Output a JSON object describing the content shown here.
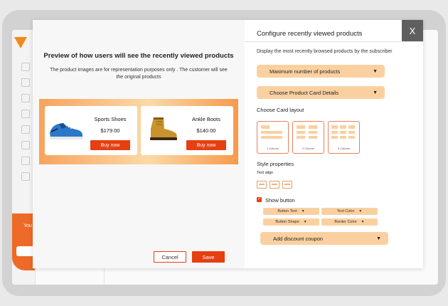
{
  "modal": {
    "preview_title": "Preview of how users will see the recently viewed products",
    "preview_note": "The product images are for representation purposes only . The customer will see the original products",
    "products": [
      {
        "name": "Sports Shoes",
        "price": "$179.00",
        "button": "Buy now"
      },
      {
        "name": "Ankle Boots",
        "price": "$140.00",
        "button": "Buy now"
      }
    ],
    "cancel_label": "Cancel",
    "save_label": "Save",
    "close_label": "X"
  },
  "config": {
    "title": "Configure recently viewed products",
    "description": "Display the most recently browsed products by the subscriber",
    "max_products_label": "Maximum number of products",
    "card_details_label": "Choose Product Card Details",
    "card_layout_heading": "Choose Card layout",
    "layouts": [
      "1 Column",
      "2 Column",
      "3 Column"
    ],
    "style_heading": "Style properties",
    "text_align_label": "Text align",
    "show_button_label": "Show button",
    "button_text_label": "Button Text",
    "text_color_label": "Text Color",
    "button_shape_label": "Button Shape",
    "border_color_label": "Border Color",
    "discount_label": "Add discount coupon"
  },
  "background": {
    "promo_text": "You"
  },
  "colors": {
    "accent": "#e53f12",
    "dropdown_fill": "#fbd0a0",
    "close_bg": "#5f5f5f"
  }
}
